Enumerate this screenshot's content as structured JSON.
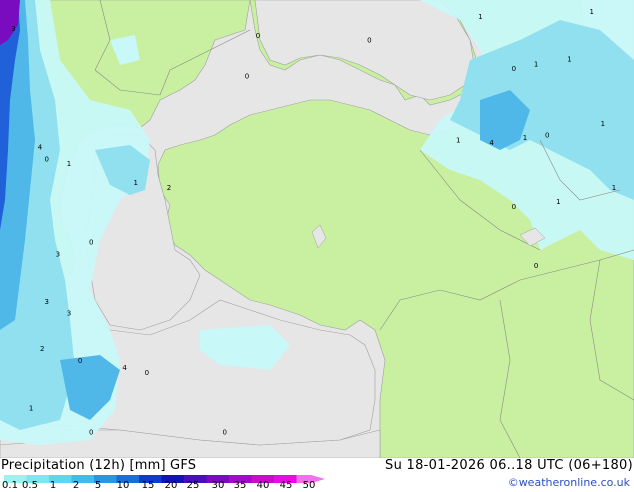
{
  "title": "Precipitation (12h) [mm] GFS",
  "datetime": "Su 18-01-2026 06..18 UTC (06+180)",
  "credit": "©weatheronline.co.uk",
  "colorbar": {
    "labels": [
      "0.1",
      "0.5",
      "1",
      "2",
      "5",
      "10",
      "15",
      "20",
      "25",
      "30",
      "35",
      "40",
      "45",
      "50"
    ],
    "colors": [
      "#a0f0f0",
      "#7fe6f0",
      "#5fd6ee",
      "#3fbce8",
      "#2a96e0",
      "#1a6ed6",
      "#0c3ec8",
      "#1414b4",
      "#4a10b8",
      "#7a0cc0",
      "#a00cc8",
      "#c80cc8",
      "#e80ce0",
      "#f070f0"
    ]
  },
  "colors": {
    "sea": "#e6e6e6",
    "land": "#c8f0a0",
    "precip_light": "#c8f8f8",
    "precip_medium": "#90e0f0",
    "precip_heavy": "#50b8e8",
    "precip_intense": "#2060d8"
  },
  "point_values": [
    {
      "label": "0",
      "lon": 33.5,
      "lat": 46.0
    },
    {
      "label": "0",
      "lon": 19.0,
      "lat": 41.0
    },
    {
      "label": "1",
      "lon": 20.0,
      "lat": 40.8
    },
    {
      "label": "4",
      "lon": 18.7,
      "lat": 41.5
    },
    {
      "label": "1",
      "lon": 23.0,
      "lat": 40.0
    },
    {
      "label": "2",
      "lon": 24.5,
      "lat": 39.8
    },
    {
      "label": "3",
      "lon": 19.5,
      "lat": 37.0
    },
    {
      "label": "0",
      "lon": 21.0,
      "lat": 37.5
    },
    {
      "label": "3",
      "lon": 19.0,
      "lat": 35.0
    },
    {
      "label": "3",
      "lon": 20.0,
      "lat": 34.5
    },
    {
      "label": "2",
      "lon": 18.8,
      "lat": 33.0
    },
    {
      "label": "0",
      "lon": 20.5,
      "lat": 32.5
    },
    {
      "label": "4",
      "lon": 22.5,
      "lat": 32.2
    },
    {
      "label": "0",
      "lon": 23.5,
      "lat": 32.0
    },
    {
      "label": "1",
      "lon": 18.3,
      "lat": 30.5
    },
    {
      "label": "0",
      "lon": 21.0,
      "lat": 29.5
    },
    {
      "label": "0",
      "lon": 27.0,
      "lat": 29.5
    },
    {
      "label": "0",
      "lon": 28.0,
      "lat": 44.5
    },
    {
      "label": "1",
      "lon": 38.5,
      "lat": 47.0
    },
    {
      "label": "1",
      "lon": 43.5,
      "lat": 47.2
    },
    {
      "label": "0",
      "lon": 40.0,
      "lat": 44.8
    },
    {
      "label": "1",
      "lon": 41.0,
      "lat": 45.0
    },
    {
      "label": "1",
      "lon": 42.5,
      "lat": 45.2
    },
    {
      "label": "1",
      "lon": 44.0,
      "lat": 42.5
    },
    {
      "label": "1",
      "lon": 37.5,
      "lat": 41.8
    },
    {
      "label": "4",
      "lon": 39.0,
      "lat": 41.7
    },
    {
      "label": "1",
      "lon": 40.5,
      "lat": 41.9
    },
    {
      "label": "0",
      "lon": 41.5,
      "lat": 42.0
    },
    {
      "label": "1",
      "lon": 42.0,
      "lat": 39.2
    },
    {
      "label": "0",
      "lon": 40.0,
      "lat": 39.0
    },
    {
      "label": "1",
      "lon": 44.5,
      "lat": 39.8
    },
    {
      "label": "0",
      "lon": 41.0,
      "lat": 36.5
    },
    {
      "label": "3",
      "lon": 17.5,
      "lat": 46.5
    },
    {
      "label": "0",
      "lon": 28.5,
      "lat": 46.2
    }
  ]
}
